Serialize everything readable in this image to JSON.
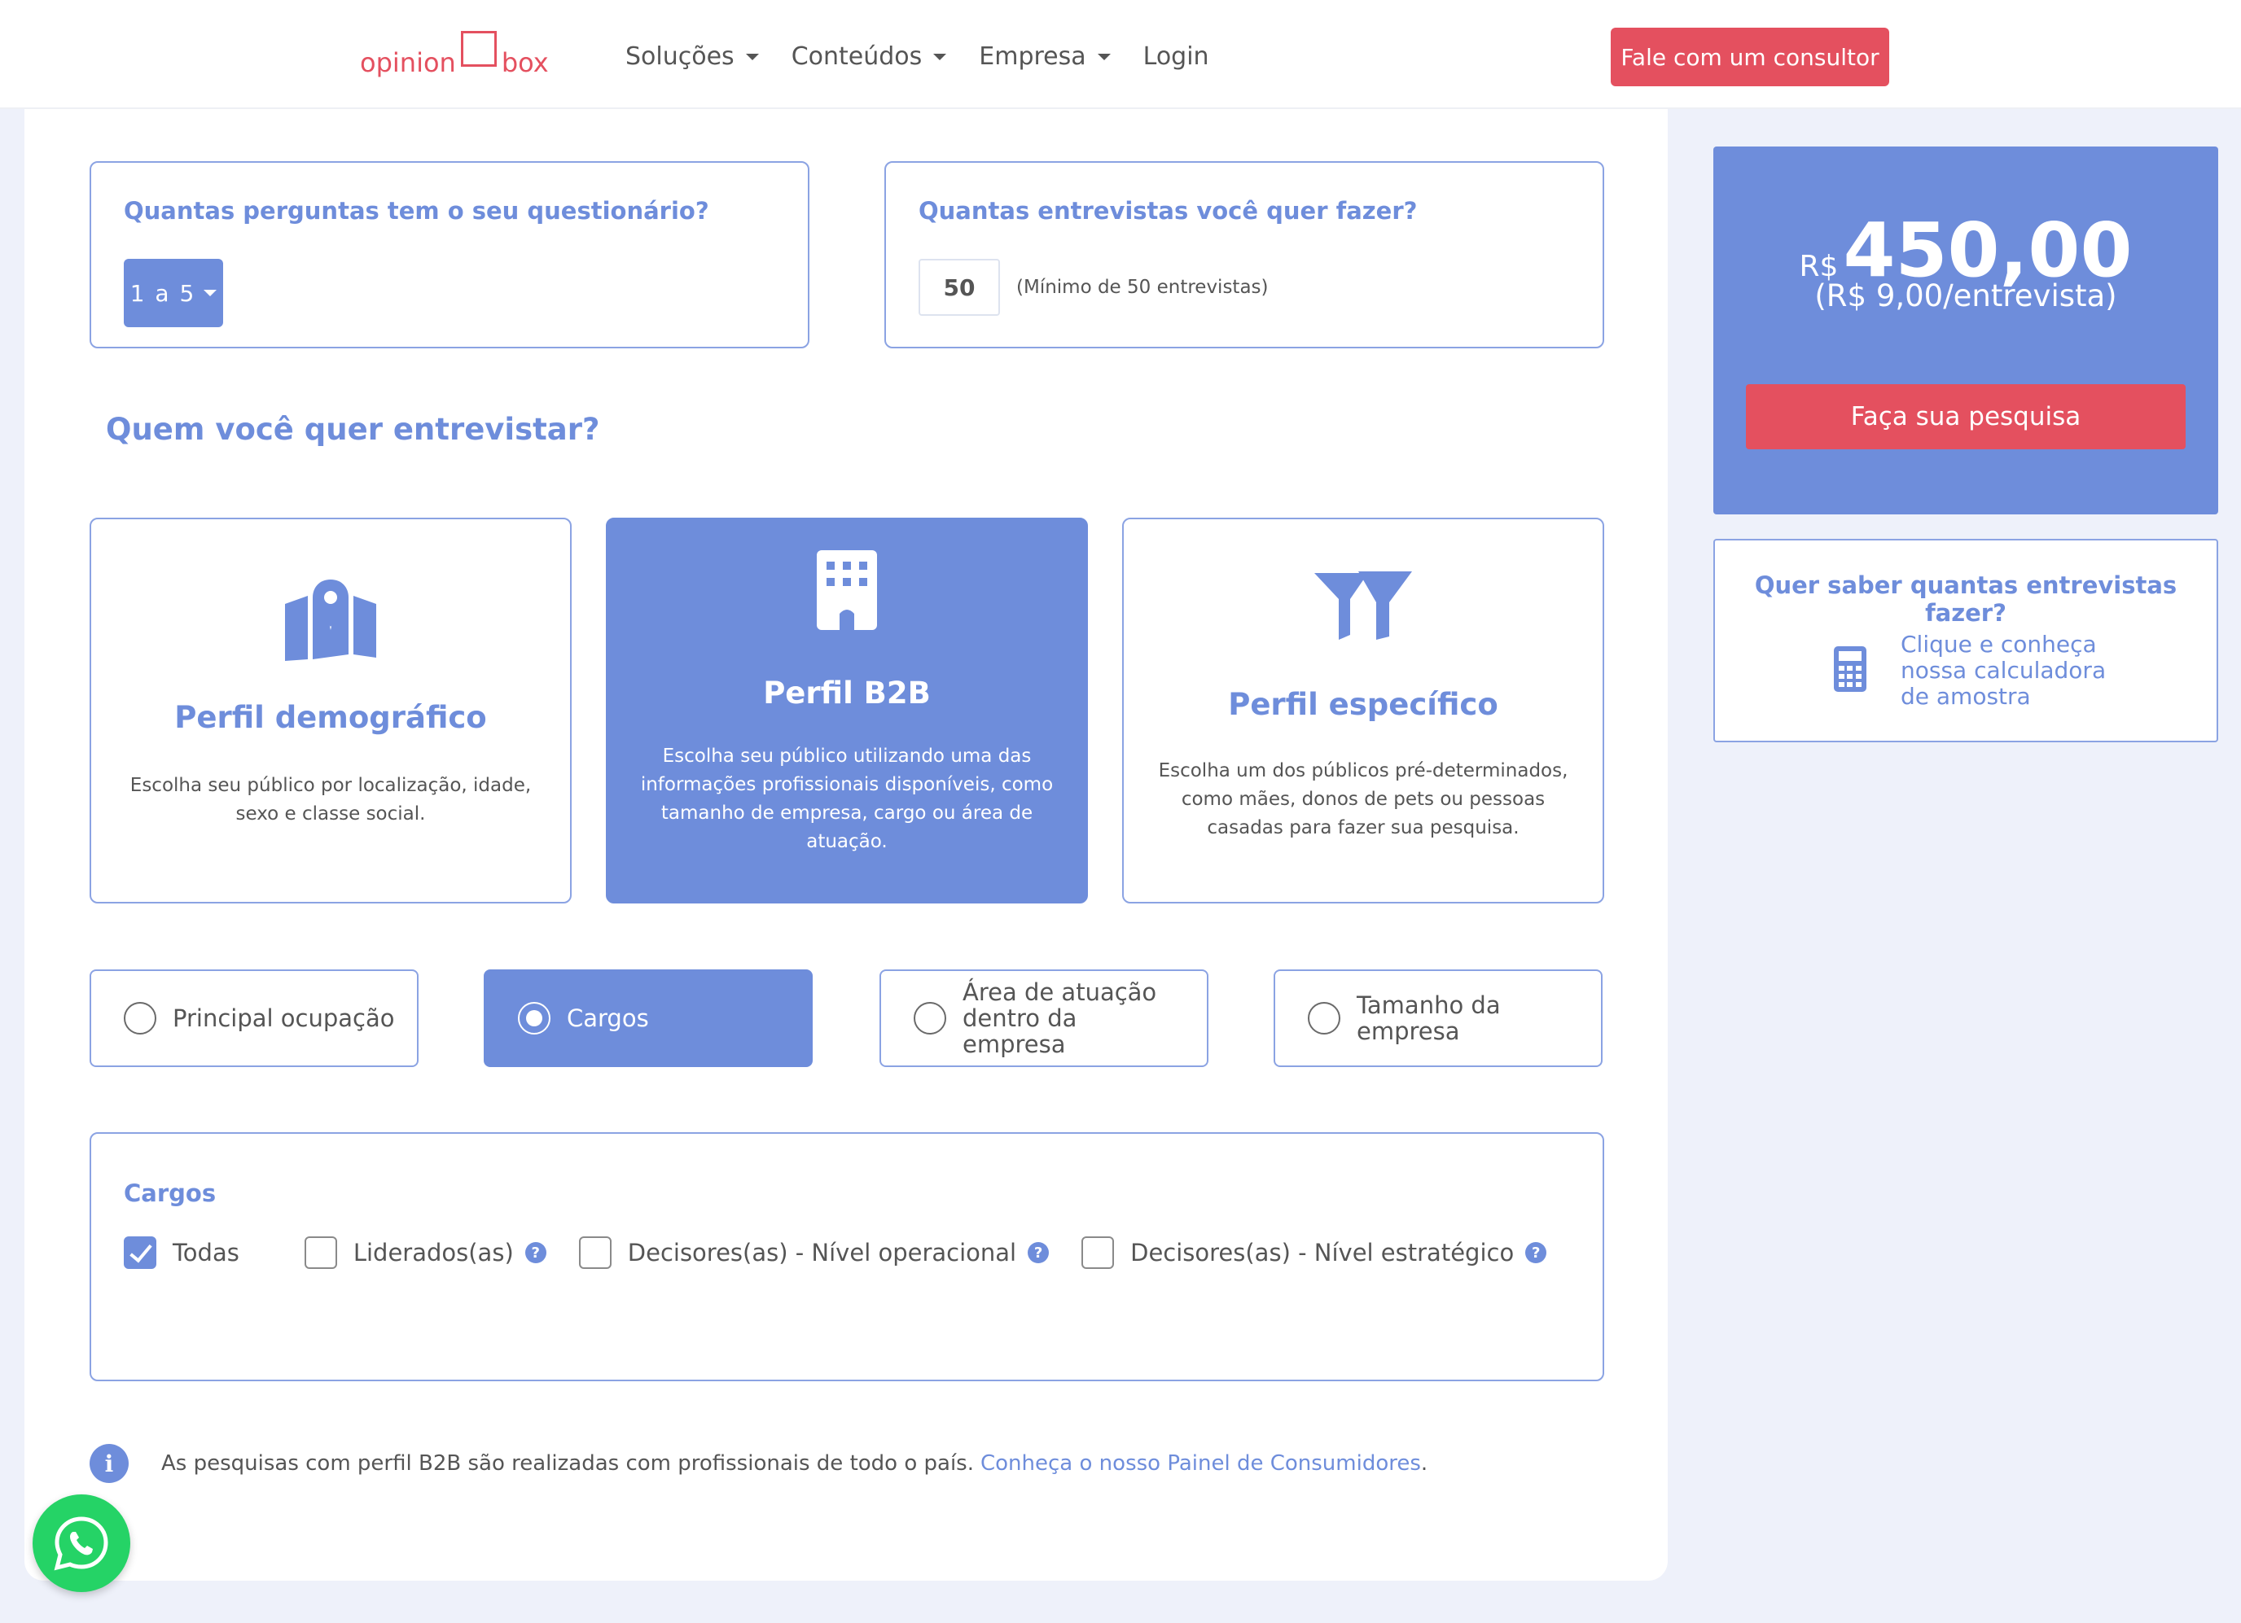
{
  "header": {
    "logo": {
      "left": "opinion",
      "right": "box"
    },
    "nav": [
      {
        "label": "Soluções",
        "has_dropdown": true
      },
      {
        "label": "Conteúdos",
        "has_dropdown": true
      },
      {
        "label": "Empresa",
        "has_dropdown": true
      },
      {
        "label": "Login",
        "has_dropdown": false
      }
    ],
    "cta_label": "Fale com um consultor"
  },
  "questions": {
    "perguntas_title": "Quantas perguntas tem o seu questionário?",
    "perguntas_value": "1 a 5",
    "entrevistas_title": "Quantas entrevistas você quer fazer?",
    "entrevistas_value": "50",
    "entrevistas_note": "(Mínimo de 50 entrevistas)"
  },
  "section_title": "Quem você quer entrevistar?",
  "profiles": [
    {
      "icon": "map-icon",
      "title": "Perfil demográfico",
      "desc": "Escolha seu público por localização, idade, sexo e classe social.",
      "active": false
    },
    {
      "icon": "building-icon",
      "title": "Perfil B2B",
      "desc": "Escolha seu público utilizando uma das informações profissionais disponíveis, como tamanho de empresa, cargo ou área de atuação.",
      "active": true
    },
    {
      "icon": "filter-icon",
      "title": "Perfil específico",
      "desc": "Escolha um dos públicos pré-determinados, como mães, donos de pets ou pessoas casadas para fazer sua pesquisa.",
      "active": false
    }
  ],
  "options": [
    {
      "label": "Principal ocupação",
      "selected": false
    },
    {
      "label": "Cargos",
      "selected": true
    },
    {
      "label": "Área de atuação dentro da empresa",
      "selected": false
    },
    {
      "label": "Tamanho da empresa",
      "selected": false
    }
  ],
  "cargos": {
    "title": "Cargos",
    "items": [
      {
        "label": "Todas",
        "checked": true,
        "help": false
      },
      {
        "label": "Liderados(as)",
        "checked": false,
        "help": true
      },
      {
        "label": "Decisores(as) - Nível operacional",
        "checked": false,
        "help": true
      },
      {
        "label": "Decisores(as) - Nível estratégico",
        "checked": false,
        "help": true
      }
    ]
  },
  "info": {
    "text": "As pesquisas com perfil B2B são realizadas com profissionais de todo o país.",
    "link": "Conheça o nosso Painel de Consumidores",
    "suffix": "."
  },
  "price": {
    "currency": "R$",
    "value": "450,00",
    "per": "(R$ 9,00/entrevista)",
    "button": "Faça sua pesquisa"
  },
  "calculator": {
    "title": "Quer saber quantas entrevistas fazer?",
    "lines": [
      "Clique e conheça",
      "nossa calculadora",
      "de amostra"
    ]
  },
  "colors": {
    "accent": "#6e8ddb",
    "cta": "#e4505f",
    "whatsapp": "#25d366"
  }
}
